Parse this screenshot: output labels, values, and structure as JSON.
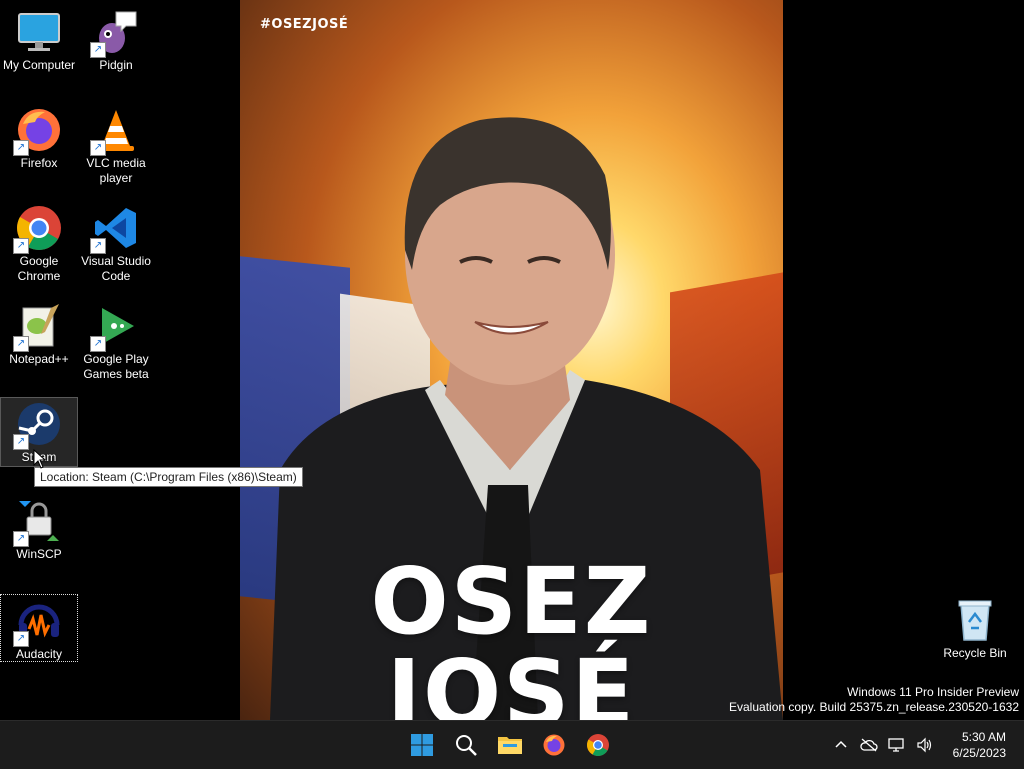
{
  "desktop": {
    "icons": [
      {
        "label": "My Computer",
        "icon": "monitor-icon"
      },
      {
        "label": "Pidgin",
        "icon": "pidgin-icon"
      },
      {
        "label": "Firefox",
        "icon": "firefox-icon"
      },
      {
        "label": "VLC media player",
        "icon": "vlc-icon"
      },
      {
        "label": "Google Chrome",
        "icon": "chrome-icon"
      },
      {
        "label": "Visual Studio Code",
        "icon": "vscode-icon"
      },
      {
        "label": "Notepad++",
        "icon": "notepadpp-icon"
      },
      {
        "label": "Google Play Games beta",
        "icon": "google-play-games-icon"
      },
      {
        "label": "Steam",
        "icon": "steam-icon"
      },
      {
        "label": "WinSCP",
        "icon": "winscp-icon"
      },
      {
        "label": "Audacity",
        "icon": "audacity-icon"
      },
      {
        "label": "Recycle Bin",
        "icon": "recycle-bin-icon"
      }
    ],
    "tooltip": "Location: Steam (C:\\Program Files (x86)\\Steam)",
    "wallpaper": {
      "hashtag": "#OSEZJOSÉ",
      "line1": "OSEZ",
      "line2": "JOSÉ"
    },
    "watermark": {
      "line1": "Windows 11 Pro Insider Preview",
      "line2": "Evaluation copy. Build 25375.zn_release.230520-1632"
    }
  },
  "taskbar": {
    "apps": [
      "start-icon",
      "search-icon",
      "file-explorer-icon",
      "firefox-icon",
      "chrome-icon"
    ],
    "tray": [
      "chevron-up-icon",
      "cloud-off-icon",
      "network-icon",
      "volume-icon"
    ],
    "time": "5:30 AM",
    "date": "6/25/2023"
  },
  "colors": {
    "taskbar_bg": "#1c1c1c",
    "desktop_bg": "#000000",
    "accent": "#0078d4"
  }
}
